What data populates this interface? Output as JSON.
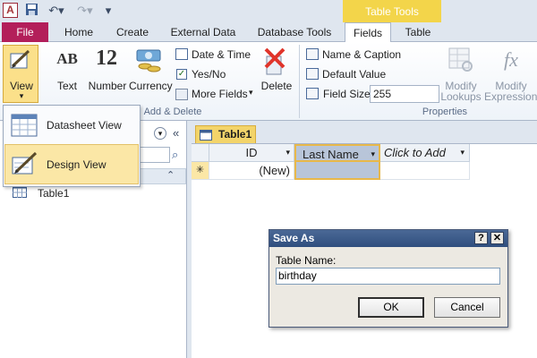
{
  "app": {
    "icon_letter": "A"
  },
  "contextual": {
    "table_tools": "Table Tools"
  },
  "tabs": {
    "file": "File",
    "home": "Home",
    "create": "Create",
    "external_data": "External Data",
    "database_tools": "Database Tools",
    "fields": "Fields",
    "table": "Table"
  },
  "ribbon": {
    "view": "View",
    "text": "Text",
    "number": "Number",
    "currency": "Currency",
    "date_time": "Date & Time",
    "yes_no": "Yes/No",
    "more_fields": "More Fields",
    "delete": "Delete",
    "add_delete_group": "Add & Delete",
    "name_caption": "Name & Caption",
    "default_value": "Default Value",
    "field_size_label": "Field Size",
    "field_size_value": "255",
    "modify_lookups_1": "Modify",
    "modify_lookups_2": "Lookups",
    "modify_expression_1": "Modify",
    "modify_expression_2": "Expression",
    "properties_group": "Properties",
    "number_icon_text": "12",
    "text_icon_text": "AB",
    "expression_icon_text": "fx"
  },
  "view_menu": {
    "datasheet_view": "Datasheet View",
    "design_view": "Design View"
  },
  "nav": {
    "items": [
      "Table1"
    ]
  },
  "document": {
    "tab_title": "Table1",
    "columns": [
      "ID",
      "Last Name",
      "Click to Add"
    ],
    "new_row": {
      "id": "(New)",
      "marker": "✳"
    }
  },
  "dialog": {
    "title": "Save As",
    "help": "?",
    "close": "✕",
    "label": "Table Name:",
    "value": "birthday",
    "ok": "OK",
    "cancel": "Cancel"
  },
  "colors": {
    "file_tab": "#b31f5a",
    "table_tools": "#f3d54a",
    "selected_menu": "#fbe7a6",
    "dialog_title": "#2f4e7e"
  }
}
